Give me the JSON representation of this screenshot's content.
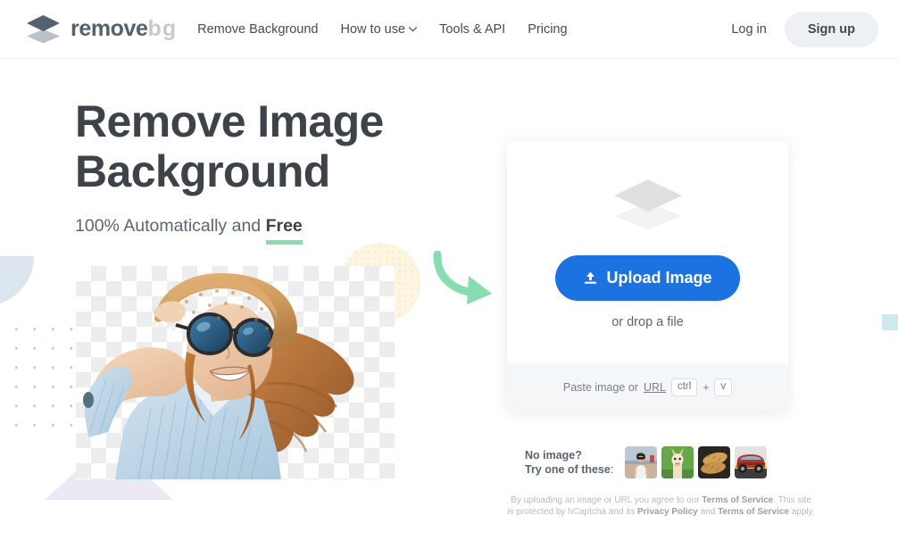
{
  "header": {
    "logo": {
      "icon": "layers-diamond-icon",
      "name_primary": "remove",
      "name_secondary": "bg"
    },
    "nav": [
      {
        "label": "Remove Background",
        "has_caret": false
      },
      {
        "label": "How to use",
        "has_caret": true
      },
      {
        "label": "Tools & API",
        "has_caret": false
      },
      {
        "label": "Pricing",
        "has_caret": false
      }
    ],
    "login_label": "Log in",
    "signup_label": "Sign up"
  },
  "hero": {
    "headline_line1": "Remove Image",
    "headline_line2": "Background",
    "subline_prefix": "100% Automatically and ",
    "subline_highlight": "Free",
    "photo_alt": "woman in straw hat and sunglasses on transparent checkerboard"
  },
  "upload": {
    "dropzone_icon": "layers-diamond-icon",
    "button_label": "Upload Image",
    "button_icon": "upload-icon",
    "drop_hint": "or drop a file",
    "paste_prefix": "Paste image or ",
    "paste_link": "URL",
    "key_ctrl": "ctrl",
    "key_plus": "+",
    "key_v": "v"
  },
  "samples": {
    "line1": "No image?",
    "line2": "Try one of these",
    "line2_suffix": ":",
    "thumbnails": [
      {
        "name": "sample-woman"
      },
      {
        "name": "sample-alpaca"
      },
      {
        "name": "sample-bread"
      },
      {
        "name": "sample-car"
      }
    ]
  },
  "legal": {
    "part1": "By uploading an image or URL you agree to our ",
    "terms1": "Terms of Service",
    "part2": ". This site is protected by hCaptcha and its ",
    "privacy": "Privacy Policy",
    "part3": " and ",
    "terms2": "Terms of Service",
    "part4": " apply."
  },
  "colors": {
    "brand_dark": "#54616e",
    "brand_light": "#c4cace",
    "accent_blue": "#1d72e2",
    "accent_green": "#87dcb0",
    "headline": "#3d4349",
    "signup_bg": "#eef1f4"
  }
}
